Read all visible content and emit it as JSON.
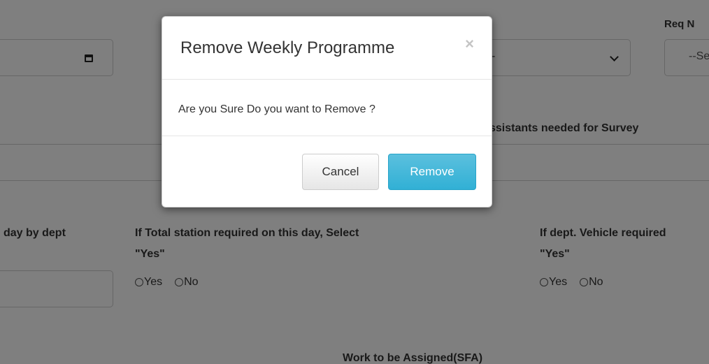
{
  "background": {
    "req_label": "Req N",
    "select_placeholder": "--Se",
    "assistants_label": "ssistants needed for Survey",
    "day_by_dept_label": "day by dept",
    "total_station_label_line1": "If Total station required on this day, Select",
    "total_station_label_line2": "\"Yes\"",
    "total_station_yes": "Yes",
    "total_station_no": "No",
    "vehicle_label_line1": "If dept. Vehicle required",
    "vehicle_label_line2": "\"Yes\"",
    "vehicle_yes": "Yes",
    "vehicle_no": "No",
    "work_assigned_label": "Work to be Assigned(SFA)",
    "dropdown_partial_text": "-"
  },
  "modal": {
    "title": "Remove Weekly Programme",
    "close_symbol": "×",
    "message": "Are you Sure Do you want to Remove ?",
    "cancel_label": "Cancel",
    "remove_label": "Remove"
  },
  "colors": {
    "overlay": "rgba(0,0,0,0.5)",
    "remove_button": "#5bc0de",
    "cancel_button": "#e6e6e6"
  }
}
